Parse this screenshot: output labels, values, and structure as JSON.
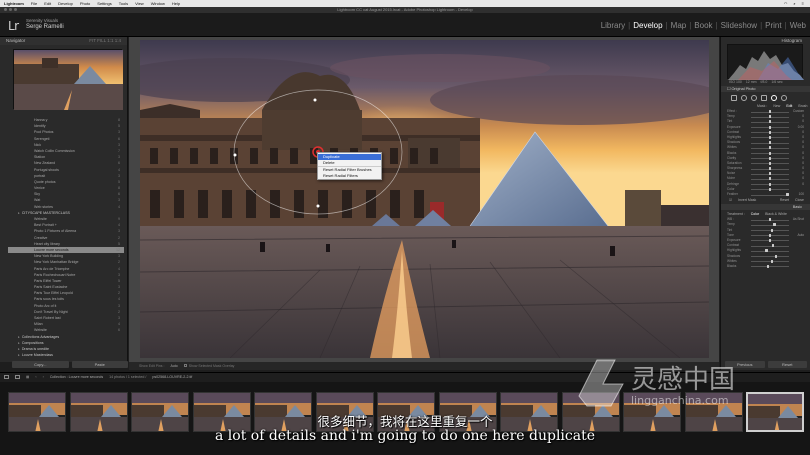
{
  "menubar": {
    "app": "Lightroom",
    "items": [
      "File",
      "Edit",
      "Develop",
      "Photo",
      "Settings",
      "Tools",
      "View",
      "Window",
      "Help"
    ]
  },
  "window": {
    "title": "Lightroom CC cat August 2015.lrcat - Adobe Photoshop Lightroom - Develop"
  },
  "identity": {
    "logo": "Lr",
    "line1": "Serenity Visuals",
    "line2": "Serge Ramelli"
  },
  "modules": {
    "items": [
      "Library",
      "Develop",
      "Map",
      "Book",
      "Slideshow",
      "Print",
      "Web"
    ],
    "active": "Develop"
  },
  "left_panel": {
    "navigator_label": "Navigator",
    "zoom_options": "FIT  FILL  1:1  1:4",
    "collections": [
      {
        "label": "Hanna y",
        "count": "8",
        "type": "item"
      },
      {
        "label": "Identify",
        "count": "5",
        "type": "item"
      },
      {
        "label": "Pool Photos",
        "count": "3",
        "type": "item"
      },
      {
        "label": "Serengeti",
        "count": "6",
        "type": "item"
      },
      {
        "label": "Nick",
        "count": "3",
        "type": "item"
      },
      {
        "label": "Watch Collin Commission",
        "count": "7",
        "type": "item"
      },
      {
        "label": "Station",
        "count": "3",
        "type": "item"
      },
      {
        "label": "New Zealand",
        "count": "6",
        "type": "item"
      },
      {
        "label": "Portugal shoots",
        "count": "4",
        "type": "item"
      },
      {
        "label": "portrait",
        "count": "3",
        "type": "item"
      },
      {
        "label": "Quote photos",
        "count": "5",
        "type": "item"
      },
      {
        "label": "Venice",
        "count": "8",
        "type": "item"
      },
      {
        "label": "Sky",
        "count": "6",
        "type": "item"
      },
      {
        "label": "Wat",
        "count": "3",
        "type": "item"
      },
      {
        "label": "Web stories",
        "count": "4",
        "type": "item"
      },
      {
        "label": "CITYSCAPE MASTERCLASS",
        "count": "",
        "type": "group"
      },
      {
        "label": "Website",
        "count": "9",
        "type": "item"
      },
      {
        "label": "Best Portrait +",
        "count": "4",
        "type": "item"
      },
      {
        "label": "Photo 1 Fixtures of Aleena",
        "count": "3",
        "type": "item"
      },
      {
        "label": "Creative",
        "count": "2",
        "type": "item"
      },
      {
        "label": "Heart city library",
        "count": "5",
        "type": "item"
      },
      {
        "label": "Louvre more seconds",
        "count": "12",
        "type": "selected"
      },
      {
        "label": "New York Building",
        "count": "3",
        "type": "item"
      },
      {
        "label": "New York Manhattan Bridge",
        "count": "2",
        "type": "item"
      },
      {
        "label": "Paris Arc de Triomphe",
        "count": "4",
        "type": "item"
      },
      {
        "label": "Paris Rochechouart Notre",
        "count": "3",
        "type": "item"
      },
      {
        "label": "Paris Eiffel Tower",
        "count": "5",
        "type": "item"
      },
      {
        "label": "Paris Saint Eustache",
        "count": "3",
        "type": "item"
      },
      {
        "label": "Paris Tour Eiffel Leopold",
        "count": "2",
        "type": "item"
      },
      {
        "label": "Paris sous les toits",
        "count": "4",
        "type": "item"
      },
      {
        "label": "Photo Arc of it",
        "count": "3",
        "type": "item"
      },
      {
        "label": "Don't Travel By Night",
        "count": "2",
        "type": "item"
      },
      {
        "label": "Saint Robert last",
        "count": "3",
        "type": "item"
      },
      {
        "label": "Milan",
        "count": "4",
        "type": "item"
      },
      {
        "label": "Website",
        "count": "6",
        "type": "item"
      },
      {
        "label": "Collections Advantages",
        "count": "",
        "type": "group"
      },
      {
        "label": "Compositions",
        "count": "",
        "type": "group"
      },
      {
        "label": "Drama is unedite",
        "count": "",
        "type": "group"
      },
      {
        "label": "Louvre Masterclass",
        "count": "",
        "type": "group"
      }
    ],
    "copy_button": "Copy...",
    "paste_button": "Paste"
  },
  "center": {
    "context_menu": {
      "items": [
        "Duplicate",
        "Delete",
        "Reset Radial Filter Brushes",
        "Reset Radial Filters"
      ],
      "highlighted_index": 0
    },
    "toolbar": {
      "show_edit_pins_label": "Show Edit Pins :",
      "show_edit_pins_value": "Auto",
      "show_overlay_label": "Show Selected Mask Overlay"
    }
  },
  "right_panel": {
    "histogram_label": "Histogram",
    "readout": [
      "ISO 100",
      "12 mm",
      "f/8.0",
      "1/6 sec"
    ],
    "original_photo_label": "Original Photo",
    "mask_row": [
      "Mask :",
      "New",
      "Edit",
      "Brush"
    ],
    "sliders_top": [
      {
        "label": "Effect :",
        "val": "Custom",
        "pos": 0.5
      },
      {
        "label": "Temp",
        "val": "0",
        "pos": 0.5
      },
      {
        "label": "Tint",
        "val": "0",
        "pos": 0.5
      },
      {
        "label": "Exposure",
        "val": "0.00",
        "pos": 0.5
      },
      {
        "label": "Contrast",
        "val": "0",
        "pos": 0.5
      },
      {
        "label": "Highlights",
        "val": "0",
        "pos": 0.5
      },
      {
        "label": "Shadows",
        "val": "0",
        "pos": 0.5
      },
      {
        "label": "Whites",
        "val": "0",
        "pos": 0.5
      },
      {
        "label": "Blacks",
        "val": "0",
        "pos": 0.5
      },
      {
        "label": "Clarity",
        "val": "0",
        "pos": 0.5
      },
      {
        "label": "Saturation",
        "val": "0",
        "pos": 0.5
      },
      {
        "label": "Sharpness",
        "val": "0",
        "pos": 0.5
      },
      {
        "label": "Noise",
        "val": "0",
        "pos": 0.5
      },
      {
        "label": "Moire",
        "val": "0",
        "pos": 0.5
      },
      {
        "label": "Defringe",
        "val": "0",
        "pos": 0.5
      },
      {
        "label": "Color",
        "val": "",
        "pos": 0.5
      },
      {
        "label": "Feather",
        "val": "100",
        "pos": 0.96
      }
    ],
    "invert_mask_label": "Invert Mask",
    "reset_label": "Reset",
    "close_label": "Close",
    "basic_label": "Basic",
    "treatment": {
      "label": "Treatment :",
      "color": "Color",
      "bw": "Black & White"
    },
    "sliders_bottom": [
      {
        "label": "WB :",
        "val": "As Shot",
        "pos": 0.5
      },
      {
        "label": "Temp",
        "val": "",
        "pos": 0.62
      },
      {
        "label": "Tint",
        "val": "",
        "pos": 0.55
      },
      {
        "label": "Tone",
        "val": "Auto",
        "pos": 0.5
      },
      {
        "label": "Exposure",
        "val": "",
        "pos": 0.5
      },
      {
        "label": "Contrast",
        "val": "",
        "pos": 0.58
      },
      {
        "label": "Highlights",
        "val": "",
        "pos": 0.4
      },
      {
        "label": "Shadows",
        "val": "",
        "pos": 0.66
      },
      {
        "label": "Whites",
        "val": "",
        "pos": 0.55
      },
      {
        "label": "Blacks",
        "val": "",
        "pos": 0.44
      }
    ],
    "previous_button": "Previous",
    "reset_button": "Reset"
  },
  "filmstrip": {
    "path_prefix": "Collection : Louvre more seconds",
    "count_text": "14 photos / 1 selected /",
    "filename": "ps02568-LOUVRE-2-2.tif"
  },
  "subtitles": {
    "cn": "很多细节，我将在这里重复一个",
    "en": "a lot of details and i'm going to do one here duplicate"
  },
  "watermark": {
    "cn": "灵感中国",
    "url": "lingganchina.com"
  },
  "colors": {
    "panel_bg": "#2a2a2a",
    "selected_row": "#8a8a8a",
    "menu_highlight": "#3a6ed6",
    "radial_pin": "#e23030"
  }
}
